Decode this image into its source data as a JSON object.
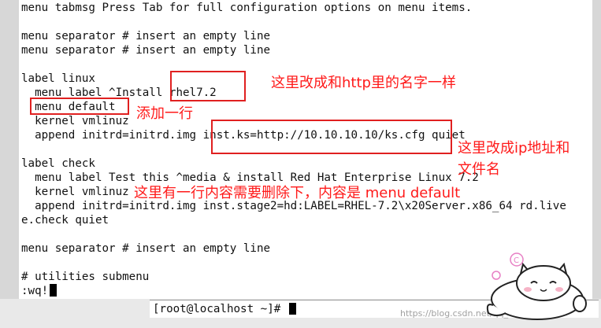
{
  "editor": {
    "lines": [
      "menu tabmsg Press Tab for full configuration options on menu items.",
      "",
      "menu separator # insert an empty line",
      "menu separator # insert an empty line",
      "",
      "label linux",
      "  menu label ^Install rhel7.2",
      "  menu default",
      "  kernel vmlinuz",
      "  append initrd=initrd.img inst.ks=http://10.10.10.10/ks.cfg quiet",
      "",
      "label check",
      "  menu label Test this ^media & install Red Hat Enterprise Linux 7.2",
      "  kernel vmlinuz",
      "  append initrd=initrd.img inst.stage2=hd:LABEL=RHEL-7.2\\x20Server.x86_64 rd.live",
      "e.check quiet",
      "",
      "menu separator # insert an empty line",
      "",
      "# utilities submenu"
    ],
    "command_line": ":wq!"
  },
  "shell": {
    "prompt": "[root@localhost ~]# "
  },
  "annotations": {
    "name_note": "这里改成和http里的名字一样",
    "add_line_note": "添加一行",
    "ip_note_line1": "这里改成ip地址和",
    "ip_note_line2": "文件名",
    "delete_note": "这里有一行内容需要删除下，内容是 menu default"
  },
  "watermark": "https://blog.csdn.net/qq_4329793",
  "colors": {
    "annotation": "#ff1a1a",
    "highlight_box": "#e02020",
    "terminal_bg": "#ffffff",
    "frame": "#d7d7d7"
  }
}
